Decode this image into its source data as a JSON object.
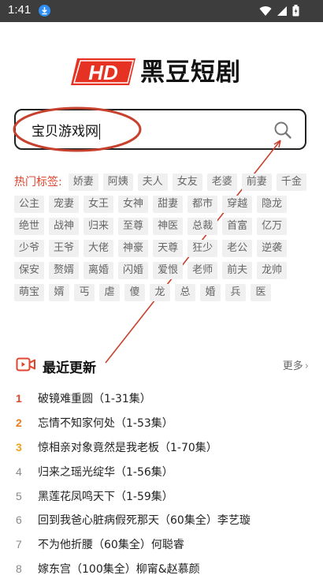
{
  "status_bar": {
    "time": "1:41"
  },
  "logo": {
    "hd_text": "HD",
    "title": "黑豆短剧"
  },
  "search": {
    "value": "宝贝游戏网"
  },
  "tags": {
    "label": "热门标签:",
    "items": [
      "娇妻",
      "阿姨",
      "夫人",
      "女友",
      "老婆",
      "前妻",
      "千金",
      "公主",
      "宠妻",
      "女王",
      "女神",
      "甜妻",
      "都市",
      "穿越",
      "隐龙",
      "绝世",
      "战神",
      "归来",
      "至尊",
      "神医",
      "总裁",
      "首富",
      "亿万",
      "少爷",
      "王爷",
      "大佬",
      "神豪",
      "天尊",
      "狂少",
      "老公",
      "逆袭",
      "保安",
      "赘婿",
      "离婚",
      "闪婚",
      "爱恨",
      "老师",
      "前夫",
      "龙帅",
      "萌宝",
      "婿",
      "丐",
      "虐",
      "傻",
      "龙",
      "总",
      "婚",
      "兵",
      "医"
    ]
  },
  "recent": {
    "title": "最近更新",
    "more_label": "更多",
    "items": [
      {
        "rank": "1",
        "title": "破镜难重圆（1-31集）"
      },
      {
        "rank": "2",
        "title": "忘情不知家何处（1-53集）"
      },
      {
        "rank": "3",
        "title": "惊相亲对象竟然是我老板（1-70集）"
      },
      {
        "rank": "4",
        "title": "归来之瑶光绽华（1-56集）"
      },
      {
        "rank": "5",
        "title": "黑莲花凤鸣天下（1-59集）"
      },
      {
        "rank": "6",
        "title": "回到我爸心脏病假死那天（60集全）李艺璇"
      },
      {
        "rank": "7",
        "title": "不为他折腰（60集全）何聪睿"
      },
      {
        "rank": "8",
        "title": "嫁东宫（100集全）柳甯&赵慕颜"
      }
    ]
  },
  "colors": {
    "accent": "#e0442c",
    "annotation": "#c8412e"
  }
}
